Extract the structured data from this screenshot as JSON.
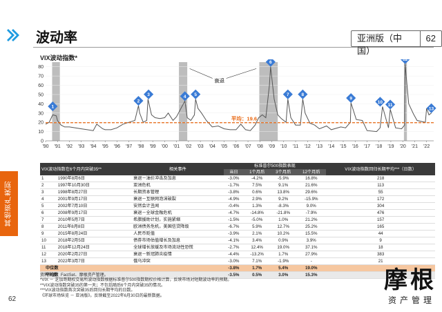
{
  "page": {
    "title": "波动率",
    "edition": "亚洲版（中国）",
    "page_number": "62",
    "side_tab": "其他资产类别",
    "side_page_number": "62"
  },
  "colors": {
    "accent": "#e8650e",
    "brand_blue": "#1f9be0",
    "marker_blue": "#3a7bd5",
    "recession": "#bdbdbd",
    "series": "#555555",
    "average": "#e8650e"
  },
  "chart_data": {
    "type": "line",
    "title": "VIX波动指数*",
    "annotations": {
      "recession_label": "衰退",
      "average_label": "平均：19.6"
    },
    "average": 19.6,
    "ylim": [
      0,
      85
    ],
    "xlim": [
      1990,
      2022.6
    ],
    "x_ticks": [
      "'90",
      "'91",
      "'92",
      "'93",
      "'94",
      "'95",
      "'96",
      "'97",
      "'98",
      "'99",
      "'00",
      "'01",
      "'02",
      "'03",
      "'04",
      "'05",
      "'06",
      "'07",
      "'08",
      "'09",
      "'10",
      "'11",
      "'12",
      "'13",
      "'14",
      "'15",
      "'16",
      "'17",
      "'18",
      "'19",
      "'20",
      "'21",
      "'22"
    ],
    "y_ticks": [
      "0",
      "10",
      "20",
      "30",
      "40",
      "50",
      "60",
      "70",
      "80"
    ],
    "recessions": [
      [
        1990.55,
        1991.2
      ],
      [
        2001.2,
        2001.9
      ],
      [
        2007.95,
        2009.5
      ],
      [
        2020.1,
        2020.35
      ]
    ],
    "x": [
      1990.0,
      1990.3,
      1990.6,
      1990.9,
      1991.0,
      1991.3,
      1991.6,
      1992.0,
      1992.5,
      1993.0,
      1993.5,
      1994.0,
      1994.3,
      1994.8,
      1995.0,
      1995.5,
      1996.0,
      1996.5,
      1997.0,
      1997.5,
      1997.8,
      1997.9,
      1998.2,
      1998.5,
      1998.6,
      1998.9,
      1999.2,
      1999.6,
      2000.0,
      2000.3,
      2000.7,
      2001.0,
      2001.7,
      2001.9,
      2002.2,
      2002.5,
      2002.6,
      2002.8,
      2003.1,
      2003.5,
      2004.0,
      2004.5,
      2005.0,
      2005.5,
      2006.0,
      2006.4,
      2006.8,
      2007.2,
      2007.6,
      2007.9,
      2008.2,
      2008.5,
      2008.8,
      2008.9,
      2009.2,
      2009.5,
      2009.8,
      2010.2,
      2010.35,
      2010.6,
      2011.0,
      2011.4,
      2011.6,
      2011.8,
      2012.2,
      2012.6,
      2013.0,
      2013.6,
      2014.0,
      2014.8,
      2015.2,
      2015.6,
      2015.65,
      2016.1,
      2016.6,
      2017.0,
      2017.8,
      2018.1,
      2018.3,
      2018.8,
      2018.95,
      2019.4,
      2019.9,
      2020.15,
      2020.2,
      2020.5,
      2020.9,
      2021.2,
      2021.9,
      2022.0,
      2022.2,
      2022.4
    ],
    "y": [
      18,
      20,
      28,
      27,
      22,
      17,
      15,
      15,
      14,
      13,
      12,
      11,
      18,
      13,
      12,
      12,
      14,
      18,
      20,
      22,
      38,
      30,
      20,
      22,
      45,
      28,
      25,
      24,
      25,
      30,
      22,
      26,
      43,
      25,
      22,
      28,
      45,
      35,
      30,
      22,
      15,
      16,
      13,
      12,
      12,
      18,
      12,
      11,
      17,
      25,
      28,
      25,
      60,
      80,
      45,
      28,
      24,
      20,
      45,
      25,
      17,
      17,
      45,
      30,
      19,
      17,
      13,
      16,
      12,
      15,
      14,
      20,
      41,
      23,
      22,
      11,
      10,
      14,
      37,
      14,
      34,
      14,
      13,
      17,
      83,
      40,
      29,
      22,
      20,
      35,
      28,
      30
    ],
    "markers": [
      {
        "id": "1",
        "x": 1990.6,
        "y": 32
      },
      {
        "id": "2",
        "x": 1997.8,
        "y": 38
      },
      {
        "id": "3",
        "x": 1998.65,
        "y": 45
      },
      {
        "id": "4",
        "x": 2001.7,
        "y": 43
      },
      {
        "id": "5",
        "x": 2002.6,
        "y": 45
      },
      {
        "id": "6",
        "x": 2008.9,
        "y": 80
      },
      {
        "id": "7",
        "x": 2010.35,
        "y": 45
      },
      {
        "id": "8",
        "x": 2011.6,
        "y": 45
      },
      {
        "id": "9",
        "x": 2015.65,
        "y": 41
      },
      {
        "id": "10",
        "x": 2018.1,
        "y": 37
      },
      {
        "id": "11",
        "x": 2018.95,
        "y": 34
      },
      {
        "id": "12",
        "x": 2020.2,
        "y": 83
      },
      {
        "id": "13",
        "x": 2022.4,
        "y": 30
      }
    ]
  },
  "table": {
    "header": {
      "col1": "VIX波动指数在6个月内突破35**",
      "col2": "相关事件",
      "group": "标准普尔500指数表现",
      "last": "VIX波动指数回归长期平均***（日数）",
      "sub": [
        "当日",
        "1个月后",
        "3个月后",
        "12个月后"
      ]
    },
    "rows": [
      {
        "n": "1",
        "date": "1990年8月6日",
        "event": "衰退－油价冲击及加息",
        "d0": "-3.0%",
        "m1": "-4.2%",
        "m3": "-5.9%",
        "m12": "16.8%",
        "days": "218"
      },
      {
        "n": "2",
        "date": "1997年10月30日",
        "event": "亚洲危机",
        "d0": "-1.7%",
        "m1": "7.5%",
        "m3": "9.1%",
        "m12": "21.6%",
        "days": "113"
      },
      {
        "n": "3",
        "date": "1998年8月27日",
        "event": "长期资本管理",
        "d0": "-3.8%",
        "m1": "0.6%",
        "m3": "13.8%",
        "m12": "29.6%",
        "days": "55"
      },
      {
        "n": "4",
        "date": "2001年9月17日",
        "event": "衰退－互联网泡沫破裂",
        "d0": "-4.9%",
        "m1": "2.9%",
        "m3": "9.2%",
        "m12": "-15.9%",
        "days": "172"
      },
      {
        "n": "5",
        "date": "2002年7月10日",
        "event": "安然会计丑闻",
        "d0": "-0.4%",
        "m1": "1.3%",
        "m3": "-8.3%",
        "m12": "9.0%",
        "days": "304"
      },
      {
        "n": "6",
        "date": "2008年9月17日",
        "event": "衰退－全球金融危机",
        "d0": "-4.7%",
        "m1": "-14.8%",
        "m3": "-21.8%",
        "m12": "-7.9%",
        "days": "476"
      },
      {
        "n": "7",
        "date": "2010年5月7日",
        "event": "希腊援助计划，实施紧缩",
        "d0": "-1.5%",
        "m1": "-5.0%",
        "m3": "1.0%",
        "m12": "21.2%",
        "days": "157"
      },
      {
        "n": "8",
        "date": "2011年8月8日",
        "event": "欧洲债务危机，美国信贷降级",
        "d0": "-6.7%",
        "m1": "5.9%",
        "m3": "12.7%",
        "m12": "25.2%",
        "days": "165"
      },
      {
        "n": "9",
        "date": "2015年8月24日",
        "event": "人民币贬值",
        "d0": "-3.9%",
        "m1": "2.1%",
        "m3": "10.2%",
        "m12": "15.5%",
        "days": "44"
      },
      {
        "n": "10",
        "date": "2018年2月5日",
        "event": "债券市场估值增长及加息",
        "d0": "-4.1%",
        "m1": "3.4%",
        "m3": "0.9%",
        "m12": "3.9%",
        "days": "9"
      },
      {
        "n": "11",
        "date": "2018年12月24日",
        "event": "全球增长放缓及市场流动性恐慌",
        "d0": "-2.7%",
        "m1": "12.4%",
        "m3": "19.0%",
        "m12": "37.1%",
        "days": "18"
      },
      {
        "n": "12",
        "date": "2020年2月27日",
        "event": "衰退－新冠肺炎疫情",
        "d0": "-4.4%",
        "m1": "-13.2%",
        "m3": "1.7%",
        "m12": "27.9%",
        "days": "383"
      },
      {
        "n": "13",
        "date": "2022年3月7日",
        "event": "俄乌冲突",
        "d0": "-3.0%",
        "m1": "7.1%",
        "m3": "-1.9%",
        "m12": "-",
        "days": "21"
      }
    ],
    "median": {
      "label": "中位数",
      "d0": "-3.8%",
      "m1": "1.7%",
      "m3": "5.4%",
      "m12": "19.0%",
      "days": ""
    },
    "average": {
      "label": "平均数",
      "d0": "-3.5%",
      "m1": "0.5%",
      "m3": "3.0%",
      "m12": "15.3%",
      "days": ""
    }
  },
  "footnotes": [
    "资料来源：FactSet、摩根资产管理。",
    "*VIX － 芝加哥期权交易所波动指数根据标准普尔500指数期权价格计算，反映市场对短期波动率的预期。",
    "**VIX波动指数突破35的第一天；不包括随后6个月内突破35的情况。",
    "***VIX波动指数首次突破35后回归长期平均的日数。",
    "《环球市场纵览 － 亚洲版》。反映截至2022年6月30日的最新数据。"
  ],
  "brand": {
    "logo_text": "摩根",
    "name": "资产管理"
  }
}
